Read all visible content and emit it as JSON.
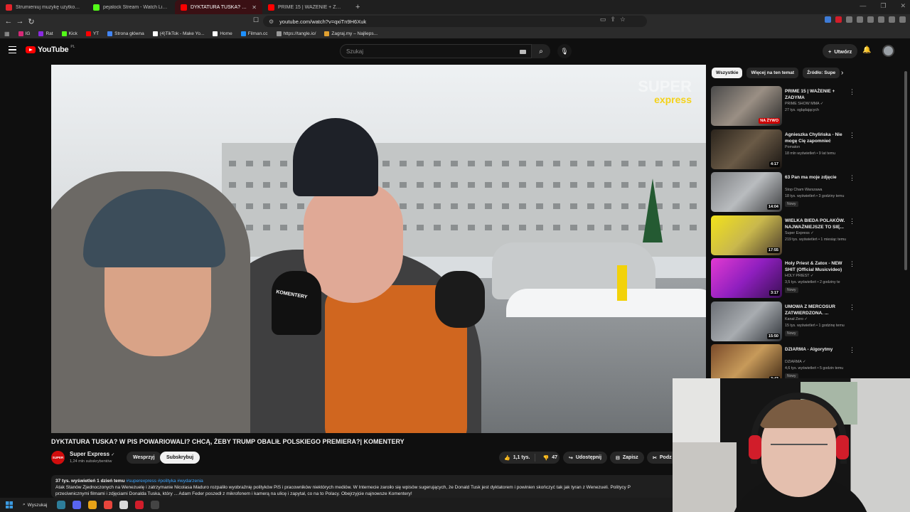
{
  "browser": {
    "tabs": [
      {
        "label": "Strumieniuj muzykę użytkownika jn",
        "color": "#e3242b",
        "active": false
      },
      {
        "label": "pejalock Stream - Watch Live on Kick",
        "color": "#53fc18",
        "active": false
      },
      {
        "label": "DYKTATURA TUSKA? W PIS P",
        "color": "#ff0000",
        "active": true
      },
      {
        "label": "PRIME 15 | WAŻENIE + ZADYMA - Yo",
        "color": "#ff0000",
        "active": false
      }
    ],
    "url": "youtube.com/watch?v=qxiTn9H6Xuk",
    "bookmarks": [
      {
        "label": "IG",
        "color": "#d62976"
      },
      {
        "label": "Rat",
        "color": "#8a2be2"
      },
      {
        "label": "Kick",
        "color": "#53fc18"
      },
      {
        "label": "YT",
        "color": "#ff0000"
      },
      {
        "label": "Strona główna",
        "color": "#4285f4"
      },
      {
        "label": "(4)TikTok - Make Yo...",
        "color": "#ffffff"
      },
      {
        "label": "Home",
        "color": "#ffffff"
      },
      {
        "label": "Filman.cc",
        "color": "#1e90ff"
      },
      {
        "label": "https://tangle.io/",
        "color": "#999999"
      },
      {
        "label": "Zagraj.my – Najlieps...",
        "color": "#e0a030"
      }
    ]
  },
  "youtube": {
    "logo_text": "YouTube",
    "logo_country": "PL",
    "search_placeholder": "Szukaj",
    "create_label": "Utwórz"
  },
  "video": {
    "watermark_top": "SUPER",
    "watermark_bottom": "express",
    "mic_label": "KOMENTERY",
    "title": "DYKTATURA TUSKA? W PIS POWARIOWALI? CHCĄ, ŻEBY TRUMP OBALIŁ POLSKIEGO PREMIERA?| KOMENTERY",
    "channel_avatar_text": "SUPER",
    "channel_name": "Super Express",
    "subscribers": "1,24 mln subskrybentów",
    "support_label": "Wesprzyj",
    "subscribe_label": "Subskrybuj",
    "likes": "1,1 tys.",
    "dislikes": "47",
    "share_label": "Udostępnij",
    "save_label": "Zapisz",
    "more_label": "Podz",
    "description": {
      "stats": "37 tys. wyświetleń  1 dzień temu",
      "tags": "#superexpress #polityka #wydarzenia",
      "line1": "Atak Stanów Zjednoczonych na Wenezuelę i zatrzymanie Nicolasa Maduro rozpaliło wyobraźnię polityków PiS i pracowników niektórych mediów. W Internecie zaroiło się wpisów sugerujących, że Donald Tusk jest dyktatorem i powinien skończyć tak jak tyran z Wenezueli.  Politycy P",
      "line2": "przeciwnicznymi filmami i zdjęciami Donalda Tuska, który ... Adam Feder poszedł z mikrofonem i kamerą na ulicę i zapytał, co na to Polacy. Obejrzyjcie najnowsze Komentery!"
    }
  },
  "sidebar": {
    "chips": [
      "Wszystkie",
      "Więcej na ten temat",
      "Źródło: Supe"
    ],
    "recommendations": [
      {
        "title": "PRIME 15 | WAŻENIE + ZADYMA",
        "channel": "PRIME SHOW MMA ✓",
        "meta": "27 tys. oglądających",
        "duration": "NA ŻYWO",
        "live": true,
        "is_new": false,
        "thumb": "linear-gradient(135deg,#4a4a4a,#9a8f84 50%,#2a2a2a)"
      },
      {
        "title": "Agnieszka Chylińska - Nie mogę Cię zapomnieć",
        "channel": "Pomaton",
        "meta": "18 mln wyświetleń • 9 lat temu",
        "duration": "4:17",
        "live": false,
        "is_new": false,
        "thumb": "linear-gradient(135deg,#2b241c,#6a5a46 50%,#191512)"
      },
      {
        "title": "63 Pan ma moje zdjęcie",
        "channel": "Stop Cham Warszawa",
        "meta": "18 tys. wyświetleń • 3 godziny temu",
        "duration": "14:04",
        "live": false,
        "is_new": true,
        "thumb": "linear-gradient(135deg,#7d7f82,#b9bcbf 50%,#3e3f41)"
      },
      {
        "title": "WIELKA BIEDA POLAKÓW. NAJWAŻNIEJSZE TO SIĘ...",
        "channel": "Super Express ✓",
        "meta": "219 tys. wyświetleń • 1 miesiąc temu",
        "duration": "17:55",
        "live": false,
        "is_new": false,
        "thumb": "linear-gradient(135deg,#f2e21a,#c9b84d 50%,#4a3b2c)"
      },
      {
        "title": "Holy Priest & Zatox - NEW SHIT (Official Musicvideo)",
        "channel": "HOLY PRIEST ✓",
        "meta": "3,5 tys. wyświetleń • 2 godziny te",
        "duration": "3:17",
        "live": false,
        "is_new": true,
        "thumb": "linear-gradient(135deg,#e23ad1,#8f1fbf 50%,#3b0f55)"
      },
      {
        "title": "UMOWA Z MERCOSUR ZATWIERDZONA. ...",
        "channel": "Kanał Zero ✓",
        "meta": "15 tys. wyświetleń • 1 godzinę temu",
        "duration": "15:50",
        "live": false,
        "is_new": true,
        "thumb": "linear-gradient(135deg,#6b6f75,#a8acb0 50%,#30343a)"
      },
      {
        "title": "DZIARMA - Algorytmy",
        "channel": "DZIARMA ✓",
        "meta": "4,6 tys. wyświetleń • 5 godzin temu",
        "duration": "3:43",
        "live": false,
        "is_new": true,
        "thumb": "linear-gradient(135deg,#7a4b2a,#c79a5a 50%,#3a2412)"
      }
    ]
  },
  "taskbar": {
    "search_label": "Wyszukaj",
    "apps": [
      "#2d7d9a",
      "#5865f2",
      "#e8a317",
      "#e8453c",
      "#d9d9d9",
      "#d11d2a",
      "#444444"
    ]
  }
}
